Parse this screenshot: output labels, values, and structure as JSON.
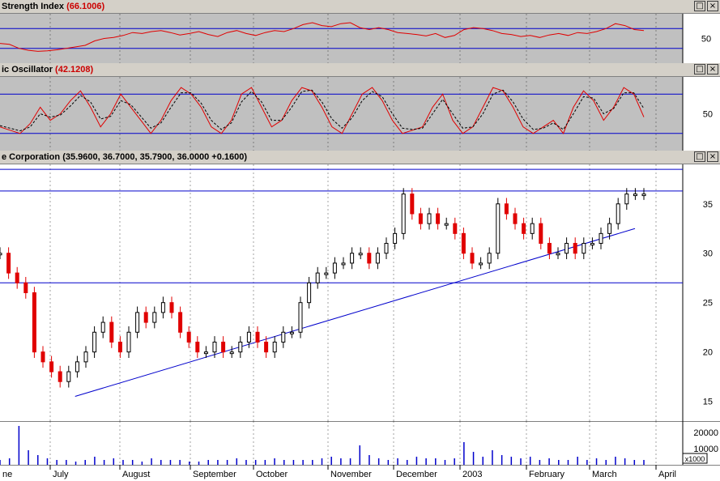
{
  "panels": {
    "rsi": {
      "title": "Strength Index",
      "value": "(66.1006)",
      "tick": "50"
    },
    "stoch": {
      "title": "ic Oscillator",
      "value": "(42.1208)",
      "tick": "50"
    },
    "price": {
      "title": "e Corporation",
      "value": "(35.9600, 36.7000, 35.7900, 36.0000 +0.1600)",
      "ticks": [
        "35",
        "30",
        "25",
        "20",
        "15"
      ]
    },
    "volume": {
      "ticks": [
        "20000",
        "10000"
      ],
      "unit": "x1000"
    }
  },
  "window_buttons": {
    "restore": "□",
    "close": "×"
  },
  "months": [
    "ne",
    "July",
    "August",
    "September",
    "October",
    "November",
    "December",
    "2003",
    "February",
    "March",
    "April"
  ],
  "colors": {
    "rsi_line": "#e00000",
    "up_candle": "#000000",
    "down_candle": "#e00000",
    "guide": "#0000cc",
    "panel_gray": "#c0c0c0",
    "trend": "#0000cc"
  },
  "chart_data": [
    {
      "type": "line",
      "title": "Strength Index",
      "ylim": [
        0,
        100
      ],
      "guide_levels": [
        70,
        30
      ],
      "last_value": 66.1006,
      "series": [
        {
          "values": [
            40,
            38,
            30,
            26,
            24,
            25,
            27,
            30,
            33,
            36,
            45,
            50,
            52,
            56,
            62,
            60,
            64,
            66,
            62,
            57,
            60,
            64,
            58,
            54,
            62,
            66,
            60,
            56,
            62,
            66,
            64,
            70,
            78,
            82,
            76,
            74,
            80,
            82,
            72,
            68,
            72,
            68,
            62,
            60,
            58,
            55,
            60,
            52,
            56,
            68,
            72,
            70,
            66,
            60,
            58,
            54,
            56,
            52,
            57,
            60,
            56,
            62,
            60,
            64,
            70,
            80,
            76,
            68,
            66
          ]
        }
      ]
    },
    {
      "type": "line",
      "title": "ic Oscillator",
      "ylim": [
        0,
        100
      ],
      "guide_levels": [
        80,
        20
      ],
      "last_value": 42.1208,
      "series": [
        {
          "values": [
            30,
            25,
            20,
            35,
            60,
            40,
            50,
            70,
            85,
            60,
            30,
            50,
            80,
            60,
            40,
            20,
            40,
            70,
            90,
            80,
            60,
            30,
            20,
            40,
            80,
            90,
            60,
            30,
            40,
            70,
            90,
            85,
            60,
            30,
            20,
            50,
            80,
            90,
            70,
            40,
            20,
            25,
            30,
            60,
            80,
            40,
            20,
            30,
            60,
            90,
            85,
            60,
            30,
            20,
            30,
            40,
            20,
            60,
            85,
            70,
            40,
            60,
            90,
            80,
            45
          ]
        },
        {
          "values": [
            32,
            28,
            24,
            30,
            50,
            45,
            48,
            62,
            78,
            68,
            42,
            46,
            70,
            64,
            46,
            28,
            36,
            60,
            82,
            82,
            66,
            40,
            26,
            36,
            68,
            84,
            68,
            40,
            40,
            60,
            84,
            86,
            68,
            42,
            28,
            44,
            70,
            84,
            76,
            50,
            28,
            26,
            28,
            50,
            72,
            50,
            28,
            30,
            50,
            80,
            86,
            68,
            42,
            26,
            28,
            36,
            26,
            50,
            76,
            74,
            50,
            58,
            82,
            82,
            58
          ]
        }
      ]
    },
    {
      "type": "candlestick",
      "title": "e Corporation",
      "ylim": [
        13,
        39
      ],
      "last": {
        "open": 35.96,
        "high": 36.7,
        "low": 35.79,
        "close": 36.0,
        "change": 0.16
      },
      "guide_levels": [
        38.5,
        36.3,
        27.0
      ],
      "trendline": {
        "from": [
          15.5,
          0.11
        ],
        "to": [
          32.5,
          0.93
        ]
      },
      "series": [
        {
          "values": [
            30,
            28,
            27,
            26,
            20,
            19,
            18,
            17,
            18,
            19,
            20,
            22,
            23,
            21,
            20,
            22,
            24,
            23,
            24,
            25,
            24,
            22,
            21,
            20,
            20,
            21,
            20,
            20,
            21,
            22,
            21,
            20,
            21,
            22,
            22,
            25,
            27,
            28,
            28,
            29,
            29,
            30,
            30,
            29,
            30,
            31,
            32,
            36,
            34,
            33,
            34,
            33,
            33,
            32,
            30,
            29,
            29,
            30,
            35,
            34,
            33,
            32,
            33,
            31,
            30,
            30,
            31,
            30,
            31,
            31,
            32,
            33,
            35,
            36,
            36,
            36
          ]
        }
      ]
    },
    {
      "type": "bar",
      "title": "",
      "ylim": [
        0,
        25000
      ],
      "series": [
        {
          "values": [
            3000,
            4000,
            24000,
            9000,
            6000,
            4000,
            3000,
            3000,
            2000,
            3000,
            5000,
            3000,
            4000,
            3000,
            3000,
            2000,
            4000,
            3000,
            3000,
            3000,
            2000,
            2000,
            3000,
            3000,
            3000,
            4000,
            3000,
            3000,
            3000,
            4000,
            3000,
            3000,
            3000,
            3000,
            4000,
            5000,
            4000,
            4000,
            12000,
            6000,
            4000,
            3000,
            4000,
            3000,
            5000,
            4000,
            4000,
            3000,
            4000,
            14000,
            8000,
            5000,
            9000,
            6000,
            5000,
            4000,
            5000,
            3000,
            4000,
            3000,
            3000,
            5000,
            3000,
            4000,
            3000,
            5000,
            4000,
            3000,
            3000
          ]
        }
      ]
    }
  ]
}
